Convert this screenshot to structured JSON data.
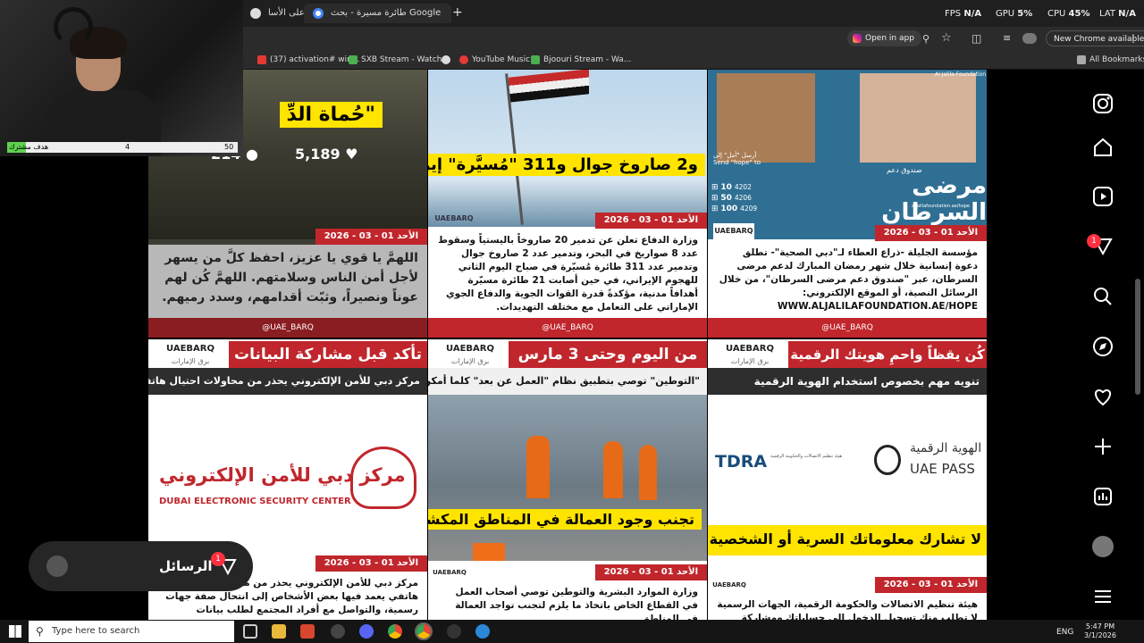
{
  "browser": {
    "tabs": [
      {
        "label": "انتر على الأسا",
        "active": false
      },
      {
        "label": "طائرة مسيرة - بحث Google",
        "active": false
      }
    ],
    "new_tab": "+",
    "stats": {
      "fps": "FPS",
      "fps_val": "N/A",
      "gpu": "GPU",
      "gpu_val": "5%",
      "cpu": "CPU",
      "cpu_val": "45%",
      "lat": "LAT",
      "lat_val": "N/A"
    },
    "open_in_app": "Open in app",
    "new_chrome": "New Chrome available",
    "bookmarks": [
      {
        "label": "(37) activation# win...",
        "color": "#e53935"
      },
      {
        "label": "SXB Stream - Watch...",
        "color": "#4caf50"
      },
      {
        "label": "",
        "color": "#ddd"
      },
      {
        "label": "YouTube Music",
        "color": "#e53935"
      },
      {
        "label": "Bjoouri Stream - Wa...",
        "color": "#4caf50"
      }
    ],
    "all_bookmarks": "All Bookmarks"
  },
  "stream": {
    "goal_label": "هدف مشترك",
    "goal_current": "4",
    "goal_target": "50",
    "goal_fraction": 0.08
  },
  "posts": [
    {
      "col": 0,
      "row": 0,
      "headline": "\"حُماة الدِّ",
      "comments": "214",
      "likes": "5,189",
      "date": "الأحد 01 - 03 - 2026",
      "text": "اللهمَّ يا قوي يا عزيز، احفظ كلَّ من يسهر لأجل أمن الناس وسلامتهم. اللهمَّ كُن لهم عوناً ونصيراً، وثبّت أقدامهم، وسدد رميهم.",
      "handle": "@UAE_BARQ"
    },
    {
      "col": 1,
      "row": 0,
      "headline": "و2 صاروخ جوال و311 \"مُسيَّرة\" إيرانية",
      "brand": "UAEBARQ",
      "date": "الأحد 01 - 03 - 2026",
      "text": "وزارة الدفاع تعلن عن تدمير 20 صاروخاً باليستياً وسقوط عدد 8 صواريخ في البحر، وتدمير عدد 2 صاروخ جوال وتدمير عدد 311 طائرة مُسيّرة في صباح اليوم الثاني للهجوم الإيراني، في حين أصابت 21 طائرة مسيّرة أهدافاً مدنية، مؤكدةً قدرة القوات الجوية والدفاع الجوي الإماراتي على التعامل مع مختلف التهديدات.",
      "handle": "@UAE_BARQ"
    },
    {
      "col": 2,
      "row": 0,
      "headline": "مرضى السرطان",
      "sub_caption": "صندوق دعم",
      "send_hope": "أرسل \"أمل\" إلى Send \"hope\" to",
      "amounts": [
        "10",
        "50",
        "100"
      ],
      "codes": [
        "4202",
        "4206",
        "4209"
      ],
      "site_small": "aljalilafoundation.ae/hope",
      "org": "Al Jalila Foundation",
      "date": "الأحد 01 - 03 - 2026",
      "text": "مؤسسة الجليلة -ذراع العطاء لـ\"دبي الصحية\"- تطلق دعوة إنسانية خلال شهر رمضان المبارك لدعم مرضى السرطان، عبر \"صندوق دعم مرضى السرطان\"، من خلال الرسائل النصية، أو الموقع الإلكتروني: WWW.ALJALILAFOUNDATION.AE/HOPE",
      "handle": "@UAE_BARQ"
    },
    {
      "col": 0,
      "row": 1,
      "title": "تأكد قبل مشاركة البيانات",
      "subtitle": "مركز دبي للأمن الإلكتروني يحذر من محاولات احتيال هاتفي",
      "brand": "UAEBARQ",
      "brand_sub": "برق الإمارات",
      "logo_ar": "مركز دبي للأمن الإلكتروني",
      "logo_en": "DUBAI ELECTRONIC SECURITY CENTER",
      "date": "الأحد 01 - 03 - 2026",
      "text": "مركز دبي للأمن الإلكتروني يحذر من محاولات احتيال هاتفي يعمد فيها بعض الأشخاص إلى انتحال صفة جهات رسمية، والتواصل مع أفراد المجتمع لطلب بيانات شخصية، مثل رقم"
    },
    {
      "col": 1,
      "row": 1,
      "title": "من اليوم وحتى 3 مارس",
      "subtitle": "\"التوطين\" توصي بتطبيق نظام \"العمل عن بعد\" كلما أمكن",
      "brand": "UAEBARQ",
      "brand_sub": "برق الإمارات",
      "headline": "تجنب وجود العمالة في المناطق المكشوفة",
      "date": "الأحد 01 - 03 - 2026",
      "text": "وزارة الموارد البشرية والتوطين توصي أصحاب العمل في القطاع الخاص باتخاذ ما يلزم لتجنب تواجد العمالة في المناطق"
    },
    {
      "col": 2,
      "row": 1,
      "title": "كُن يقظاً واحمِ هويتك الرقمية",
      "subtitle": "تنويه مهم بخصوص استخدام الهوية الرقمية",
      "brand": "UAEBARQ",
      "brand_sub": "برق الإمارات",
      "logo_left": "TDRA",
      "logo_left_sub": "هيئة تنظيم الاتصالات والحكومة الرقمية",
      "logo_right_ar": "الهوية الرقمية",
      "logo_right_en": "UAE PASS",
      "headline": "لا تشارك معلوماتك السرية أو الشخصية",
      "date": "الأحد 01 - 03 - 2026",
      "text": "هيئة تنظيم الاتصالات والحكومة الرقمية، الجهات الرسمية لا تطلب منك تسجيل الدخول إلى حساباتك ومشاركة"
    }
  ],
  "messages": {
    "label": "الرسائل",
    "badge": "1"
  },
  "nav": {
    "notification_badge": "1"
  },
  "taskbar": {
    "search_placeholder": "Type here to search",
    "lang": "ENG",
    "time": "5:47 PM",
    "date": "3/1/2026"
  }
}
